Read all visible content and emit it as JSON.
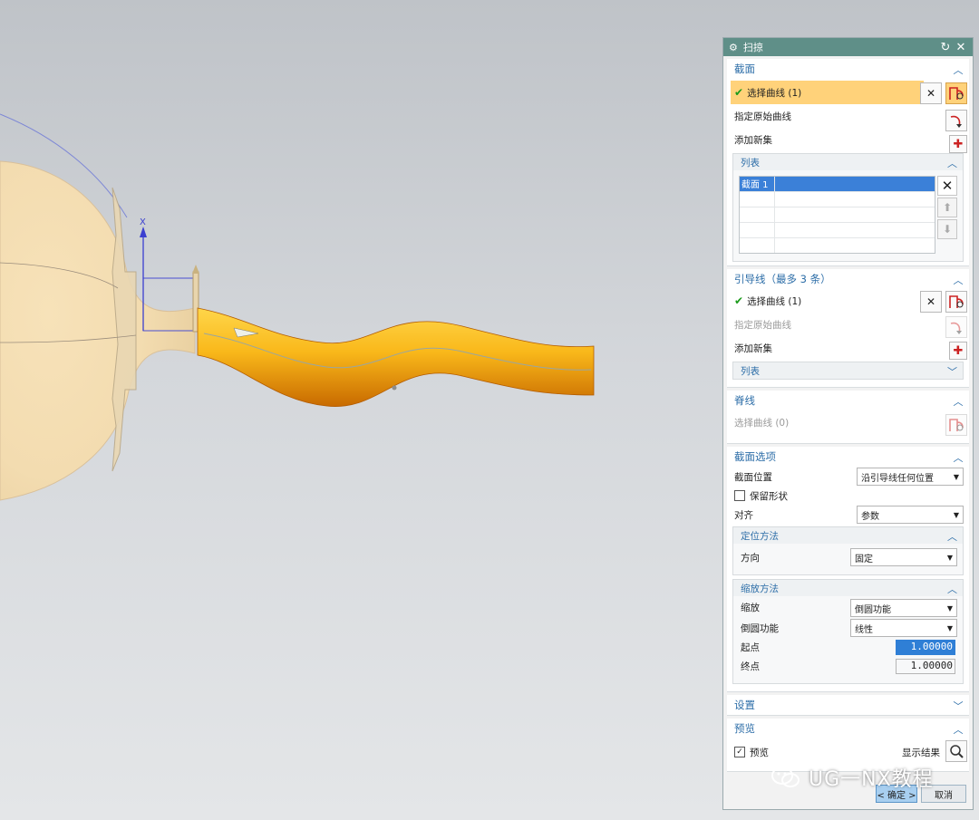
{
  "dialog": {
    "title": "扫掠"
  },
  "section": {
    "title": "截面",
    "select_curve": "选择曲线 (1)",
    "specify_origin_curve": "指定原始曲线",
    "add_new_set": "添加新集",
    "list_title": "列表",
    "list_items": [
      "截面 1"
    ]
  },
  "guide": {
    "title": "引导线（最多 3 条）",
    "select_curve": "选择曲线 (1)",
    "specify_origin_curve": "指定原始曲线",
    "add_new_set": "添加新集",
    "list_title": "列表"
  },
  "spine": {
    "title": "脊线",
    "select_curve": "选择曲线 (0)"
  },
  "section_options": {
    "title": "截面选项",
    "position_label": "截面位置",
    "position_value": "沿引导线任何位置",
    "preserve_shape": "保留形状",
    "align_label": "对齐",
    "align_value": "参数",
    "orientation_title": "定位方法",
    "direction_label": "方向",
    "direction_value": "固定",
    "scaling_title": "缩放方法",
    "scale_label": "缩放",
    "scale_value": "倒圆功能",
    "blend_label": "倒圆功能",
    "blend_value": "线性",
    "start_label": "起点",
    "start_value": "1.00000",
    "end_label": "终点",
    "end_value": "1.00000"
  },
  "settings": {
    "title": "设置"
  },
  "preview": {
    "title": "预览",
    "preview_label": "预览",
    "show_result": "显示结果"
  },
  "buttons": {
    "ok": "< 确定 >",
    "cancel": "取消"
  },
  "watermark": {
    "text": "UG一NX教程"
  },
  "viewport": {
    "axis_label": "X"
  },
  "colors": {
    "title_bar": "#5f8f88",
    "group_header": "#2d6ea8",
    "selection_highlight": "#ffd27a",
    "sweep_body": "#f6b51c",
    "bulb_body": "#f3dcb0"
  }
}
